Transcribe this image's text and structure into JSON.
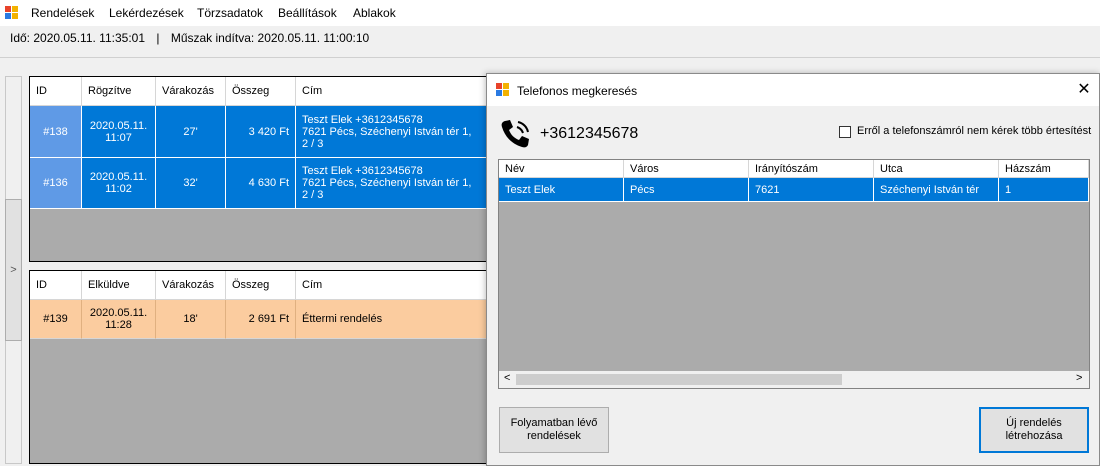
{
  "menu": [
    "Rendelések",
    "Lekérdezések",
    "Törzsadatok",
    "Beállítások",
    "Ablakok"
  ],
  "status": {
    "time": "Idő: 2020.05.11. 11:35:01",
    "separator": "|",
    "shift": "Műszak indítva: 2020.05.11. 11:00:10"
  },
  "collapse_label": ">",
  "orders_grid": {
    "headers": [
      "ID",
      "Rögzítve",
      "Várakozás",
      "Összeg",
      "Cím"
    ],
    "rows": [
      {
        "id": "#138",
        "time": "2020.05.11. 11:07",
        "wait": "27'",
        "amount": "3 420 Ft",
        "addr1": "Teszt Elek +3612345678",
        "addr2": "7621 Pécs, Széchenyi István tér 1,",
        "addr3": "2 / 3"
      },
      {
        "id": "#136",
        "time": "2020.05.11. 11:02",
        "wait": "32'",
        "amount": "4 630 Ft",
        "addr1": "Teszt Elek +3612345678",
        "addr2": "7621 Pécs, Széchenyi István tér 1,",
        "addr3": "2 / 3"
      }
    ]
  },
  "sent_grid": {
    "headers": [
      "ID",
      "Elküldve",
      "Várakozás",
      "Összeg",
      "Cím"
    ],
    "rows": [
      {
        "id": "#139",
        "time": "2020.05.11. 11:28",
        "wait": "18'",
        "amount": "2 691 Ft",
        "addr": "Éttermi rendelés"
      }
    ]
  },
  "dialog": {
    "title": "Telefonos megkeresés",
    "close": "✕",
    "phone": "+3612345678",
    "opt_out_label": "Erről a telefonszámról nem kérek több értesítést",
    "headers": [
      "Név",
      "Város",
      "Irányítószám",
      "Utca",
      "Házszám"
    ],
    "rows": [
      {
        "name": "Teszt Elek",
        "city": "Pécs",
        "zip": "7621",
        "street": "Széchenyi István tér",
        "house": "1"
      }
    ],
    "btn_in_progress": "Folyamatban lévő rendelések",
    "btn_new_order": "Új rendelés létrehozása",
    "scroll_left": "<",
    "scroll_right": ">"
  },
  "colors": {
    "selection": "#0078d7",
    "selection_first_col": "#5f9ae6",
    "sent_row": "#fbcc9f",
    "grid_empty": "#ababab"
  },
  "icons": [
    "app-icon",
    "phone-icon",
    "close-icon"
  ]
}
